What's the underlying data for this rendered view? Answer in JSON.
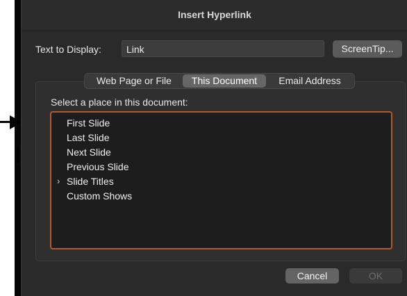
{
  "dialog": {
    "title": "Insert Hyperlink"
  },
  "display_text": {
    "label": "Text to Display:",
    "value": "Link"
  },
  "screentip_label": "ScreenTip...",
  "tabs": [
    {
      "label": "Web Page or File",
      "selected": false
    },
    {
      "label": "This Document",
      "selected": true
    },
    {
      "label": "Email Address",
      "selected": false
    }
  ],
  "place": {
    "label": "Select a place in this document:",
    "items": [
      {
        "label": "First Slide"
      },
      {
        "label": "Last Slide"
      },
      {
        "label": "Next Slide"
      },
      {
        "label": "Previous Slide"
      },
      {
        "label": "Slide Titles",
        "expandable": true
      },
      {
        "label": "Custom Shows"
      }
    ]
  },
  "buttons": {
    "cancel": "Cancel",
    "ok": "OK"
  },
  "colors": {
    "focus_ring": "#b35a2e",
    "dialog_bg": "#2a2a2a",
    "selected_tab": "#666666"
  }
}
